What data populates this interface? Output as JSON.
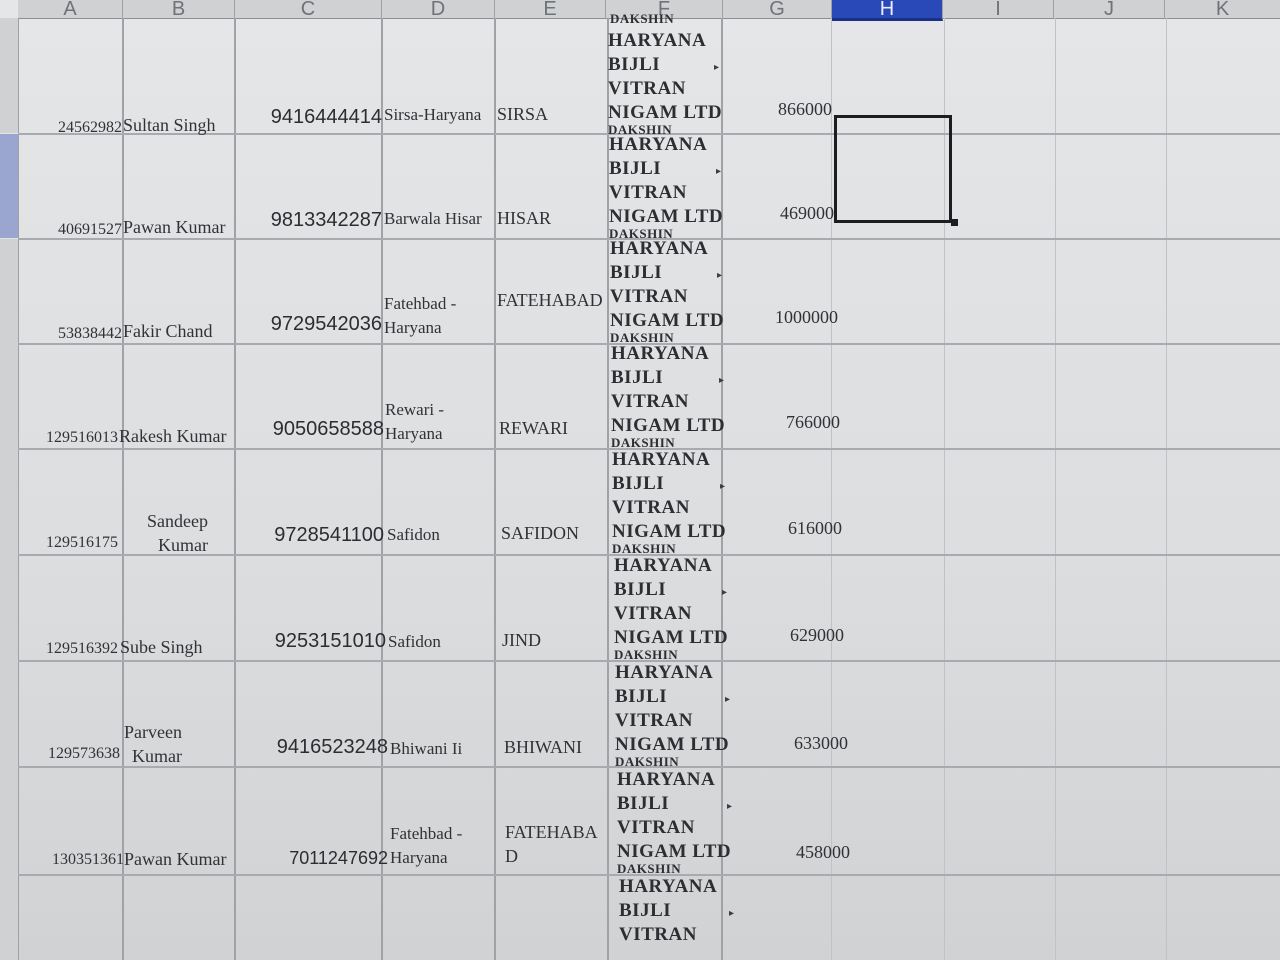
{
  "columns": [
    "A",
    "B",
    "C",
    "D",
    "E",
    "F",
    "G",
    "H",
    "I",
    "J",
    "K"
  ],
  "rows": [
    {
      "id": "24562982",
      "name": "Sultan Singh",
      "phone": "9416444414",
      "location": "Sirsa-Haryana",
      "district": "SIRSA",
      "company": [
        "HARYANA",
        "BIJLI",
        "VITRAN",
        "NIGAM LTD"
      ],
      "amount": "866000"
    },
    {
      "id": "40691527",
      "name": "Pawan Kumar",
      "phone": "9813342287",
      "location": "Barwala Hisar",
      "district": "HISAR",
      "company": [
        "HARYANA",
        "BIJLI",
        "VITRAN",
        "NIGAM LTD"
      ],
      "amount": "469000"
    },
    {
      "id": "53838442",
      "name": "Fakir Chand",
      "phone": "9729542036",
      "location": "Fatehbad - Haryana",
      "district": "FATEHABAD",
      "company": [
        "HARYANA",
        "BIJLI",
        "VITRAN",
        "NIGAM LTD"
      ],
      "amount": "1000000"
    },
    {
      "id": "129516013",
      "name": "Rakesh Kumar",
      "phone": "9050658588",
      "location": "Rewari - Haryana",
      "district": "REWARI",
      "company": [
        "HARYANA",
        "BIJLI",
        "VITRAN",
        "NIGAM LTD"
      ],
      "amount": "766000"
    },
    {
      "id": "129516175",
      "name": "Sandeep Kumar",
      "phone": "9728541100",
      "location": "Safidon",
      "district": "SAFIDON",
      "company": [
        "HARYANA",
        "BIJLI",
        "VITRAN",
        "NIGAM LTD"
      ],
      "amount": "616000"
    },
    {
      "id": "129516392",
      "name": "Sube Singh",
      "phone": "9253151010",
      "location": "Safidon",
      "district": "JIND",
      "company": [
        "HARYANA",
        "BIJLI",
        "VITRAN",
        "NIGAM LTD"
      ],
      "amount": "629000"
    },
    {
      "id": "129573638",
      "name": "Parveen Kumar",
      "phone": "9416523248",
      "location": "Bhiwani Ii",
      "district": "BHIWANI",
      "company": [
        "HARYANA",
        "BIJLI",
        "VITRAN",
        "NIGAM LTD"
      ],
      "amount": "633000"
    },
    {
      "id": "130351361",
      "name": "Pawan Kumar",
      "phone": "7011247692",
      "location": "Fatehbad - Haryana",
      "district": "FATEHABAD",
      "company": [
        "HARYANA",
        "BIJLI",
        "VITRAN",
        "NIGAM LTD"
      ],
      "amount": "458000"
    }
  ],
  "partial_row": {
    "company": [
      "HARYANA",
      "BIJLI",
      "VITRAN"
    ]
  },
  "truncated_above": "DAKSHIN"
}
